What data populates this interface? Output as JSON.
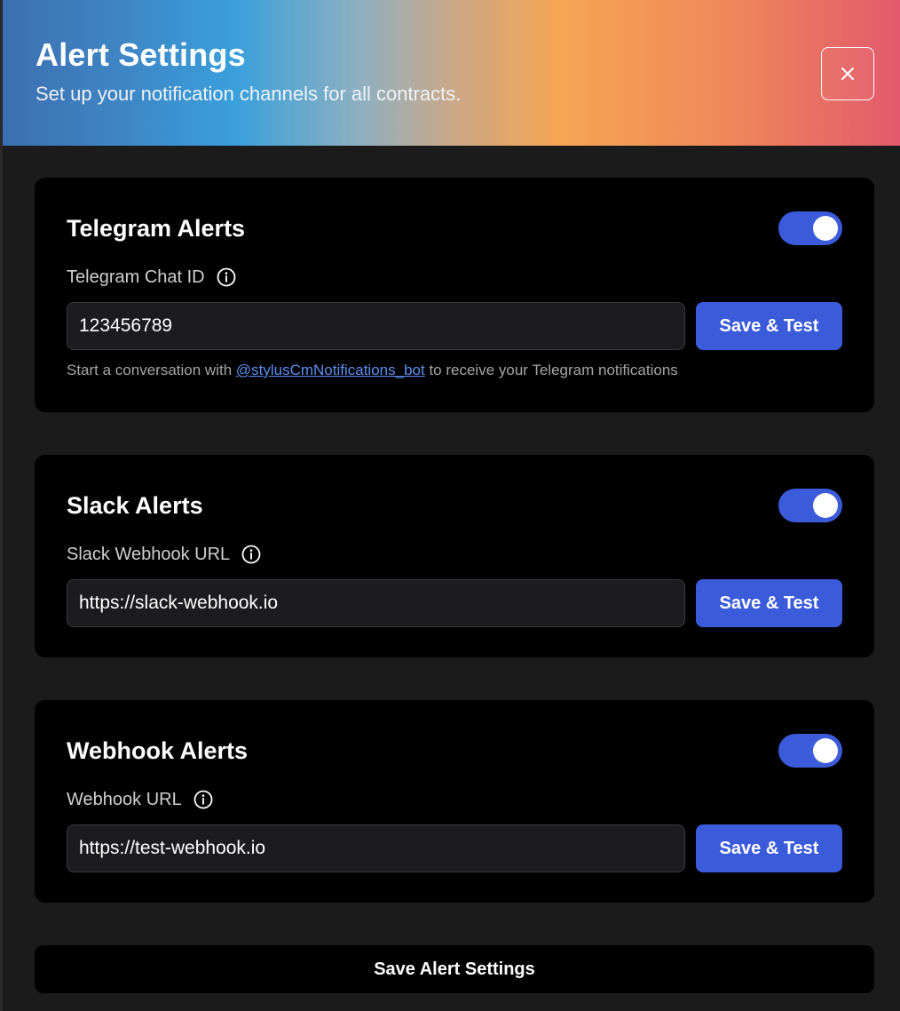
{
  "header": {
    "title": "Alert Settings",
    "subtitle": "Set up your notification channels for all contracts.",
    "close_icon": "close-icon"
  },
  "colors": {
    "accent": "#3b5bdb",
    "card_bg": "#000000",
    "panel_bg": "#1b1b1b",
    "link": "#5b8ef0"
  },
  "telegram": {
    "title": "Telegram Alerts",
    "enabled": true,
    "field_label": "Telegram Chat ID",
    "value": "123456789",
    "button": "Save & Test",
    "helper_prefix": "Start a conversation with ",
    "helper_link": "@stylusCmNotifications_bot",
    "helper_suffix": " to receive your Telegram notifications"
  },
  "slack": {
    "title": "Slack Alerts",
    "enabled": true,
    "field_label": "Slack Webhook URL",
    "value": "https://slack-webhook.io",
    "button": "Save & Test"
  },
  "webhook": {
    "title": "Webhook Alerts",
    "enabled": true,
    "field_label": "Webhook URL",
    "value": "https://test-webhook.io",
    "button": "Save & Test"
  },
  "footer": {
    "save_label": "Save Alert Settings"
  }
}
